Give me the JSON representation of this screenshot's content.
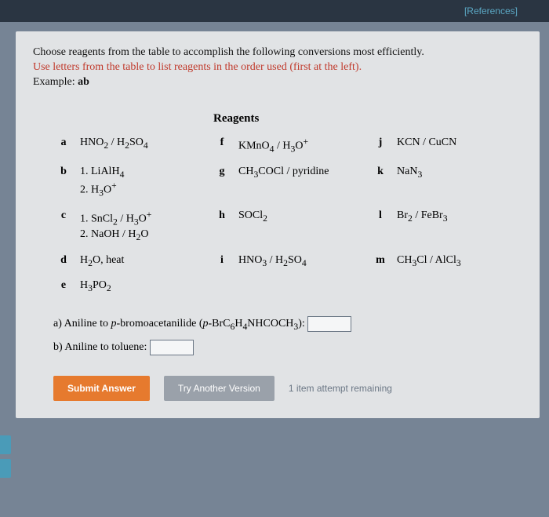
{
  "header": {
    "references_link": "[References]"
  },
  "instructions": {
    "line1": "Choose reagents from the table to accomplish the following conversions most efficiently.",
    "line2": "Use letters from the table to list reagents in the order used (first at the left).",
    "example_label": "Example:",
    "example_value": "ab"
  },
  "reagents": {
    "title": "Reagents",
    "col1": [
      {
        "label": "a",
        "html": "HNO<sub>2</sub> / H<sub>2</sub>SO<sub>4</sub>"
      },
      {
        "label": "b",
        "html": "1. LiAlH<sub>4</sub><br>2. H<sub>3</sub>O<sup>+</sup>"
      },
      {
        "label": "c",
        "html": "1. SnCl<sub>2</sub> / H<sub>3</sub>O<sup>+</sup><br>2. NaOH / H<sub>2</sub>O"
      },
      {
        "label": "d",
        "html": "H<sub>2</sub>O, heat"
      },
      {
        "label": "e",
        "html": "H<sub>3</sub>PO<sub>2</sub>"
      }
    ],
    "col2": [
      {
        "label": "f",
        "html": "KMnO<sub>4</sub> / H<sub>3</sub>O<sup>+</sup>"
      },
      {
        "label": "g",
        "html": "CH<sub>3</sub>COCl / pyridine"
      },
      {
        "label": "h",
        "html": "SOCl<sub>2</sub>"
      },
      {
        "label": "i",
        "html": "HNO<sub>3</sub> / H<sub>2</sub>SO<sub>4</sub>"
      }
    ],
    "col3": [
      {
        "label": "j",
        "html": "KCN / CuCN"
      },
      {
        "label": "k",
        "html": "NaN<sub>3</sub>"
      },
      {
        "label": "l",
        "html": "Br<sub>2</sub> / FeBr<sub>3</sub>"
      },
      {
        "label": "m",
        "html": "CH<sub>3</sub>Cl / AlCl<sub>3</sub>"
      }
    ]
  },
  "questions": {
    "a_prefix": "a) Aniline to ",
    "a_ital": "p",
    "a_rest": "-bromoacetanilide (",
    "a_ital2": "p",
    "a_formula": "-BrC<sub>6</sub>H<sub>4</sub>NHCOCH<sub>3</sub>):",
    "a_value": "",
    "b_text": "b) Aniline to toluene:",
    "b_value": ""
  },
  "buttons": {
    "submit": "Submit Answer",
    "try_another": "Try Another Version",
    "attempts": "1 item attempt remaining"
  }
}
